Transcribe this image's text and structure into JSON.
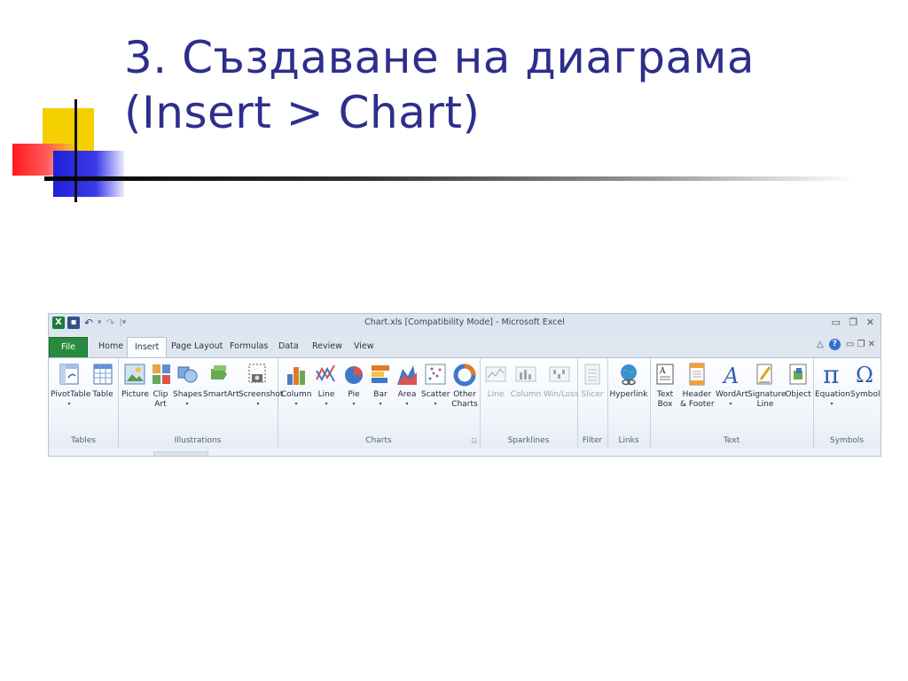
{
  "slide": {
    "title_line1": "3. Създаване на диаграма",
    "title_line2": "(Insert > Chart)"
  },
  "excel": {
    "window_title": "Chart.xls [Compatibility Mode] - Microsoft Excel",
    "tabs": [
      {
        "label": "File"
      },
      {
        "label": "Home"
      },
      {
        "label": "Insert"
      },
      {
        "label": "Page Layout"
      },
      {
        "label": "Formulas"
      },
      {
        "label": "Data"
      },
      {
        "label": "Review"
      },
      {
        "label": "View"
      }
    ],
    "active_tab": "Insert",
    "groups": [
      {
        "label": "Tables",
        "buttons": [
          {
            "label": "PivotTable",
            "icon": "pivottable-icon"
          },
          {
            "label": "Table",
            "icon": "table-icon"
          }
        ]
      },
      {
        "label": "Illustrations",
        "buttons": [
          {
            "label": "Picture",
            "icon": "picture-icon"
          },
          {
            "label": "Clip\nArt",
            "icon": "clip-art-icon"
          },
          {
            "label": "Shapes",
            "icon": "shapes-icon"
          },
          {
            "label": "SmartArt",
            "icon": "smartart-icon"
          },
          {
            "label": "Screenshot",
            "icon": "screenshot-icon"
          }
        ]
      },
      {
        "label": "Charts",
        "buttons": [
          {
            "label": "Column",
            "icon": "column-chart-icon"
          },
          {
            "label": "Line",
            "icon": "line-chart-icon"
          },
          {
            "label": "Pie",
            "icon": "pie-chart-icon"
          },
          {
            "label": "Bar",
            "icon": "bar-chart-icon"
          },
          {
            "label": "Area",
            "icon": "area-chart-icon"
          },
          {
            "label": "Scatter",
            "icon": "scatter-chart-icon"
          },
          {
            "label": "Other\nCharts",
            "icon": "other-charts-icon"
          }
        ]
      },
      {
        "label": "Sparklines",
        "buttons": [
          {
            "label": "Line",
            "icon": "sparkline-line-icon"
          },
          {
            "label": "Column",
            "icon": "sparkline-column-icon"
          },
          {
            "label": "Win/Loss",
            "icon": "sparkline-winloss-icon"
          }
        ]
      },
      {
        "label": "Filter",
        "buttons": [
          {
            "label": "Slicer",
            "icon": "slicer-icon"
          }
        ]
      },
      {
        "label": "Links",
        "buttons": [
          {
            "label": "Hyperlink",
            "icon": "hyperlink-icon"
          }
        ]
      },
      {
        "label": "Text",
        "buttons": [
          {
            "label": "Text\nBox",
            "icon": "text-box-icon"
          },
          {
            "label": "Header\n& Footer",
            "icon": "header-footer-icon"
          },
          {
            "label": "WordArt",
            "icon": "wordart-icon"
          },
          {
            "label": "Signature\nLine",
            "icon": "signature-line-icon"
          },
          {
            "label": "Object",
            "icon": "object-icon"
          }
        ]
      },
      {
        "label": "Symbols",
        "buttons": [
          {
            "label": "Equation",
            "icon": "equation-icon"
          },
          {
            "label": "Symbol",
            "icon": "symbol-icon"
          }
        ]
      }
    ],
    "colors": {
      "file_tab": "#2a8a3f",
      "title_text": "#2e2e8c",
      "ribbon_bg": "#f0f4fa"
    }
  }
}
